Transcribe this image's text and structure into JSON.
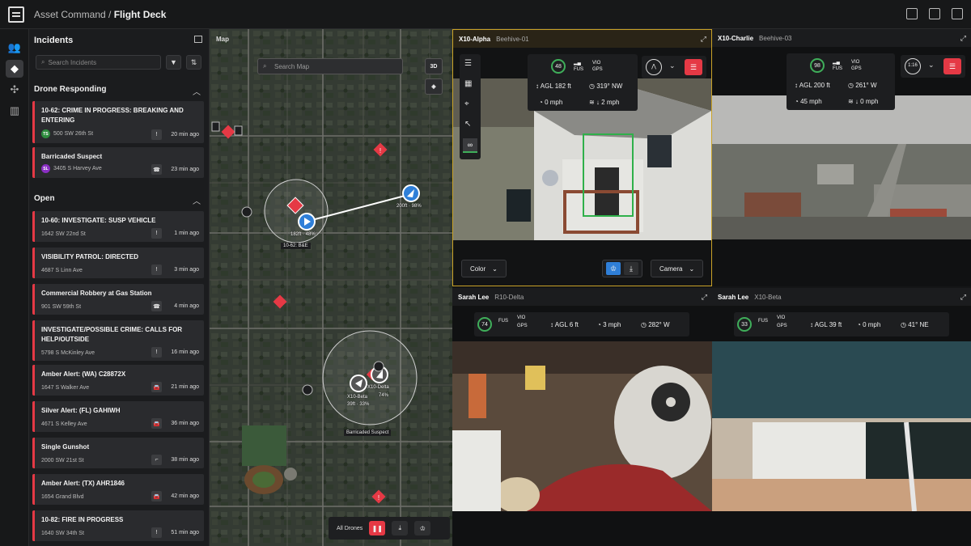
{
  "app": {
    "org": "Asset Command",
    "sep": " / ",
    "page": "Flight Deck"
  },
  "incidents": {
    "title": "Incidents",
    "search_placeholder": "Search Incidents",
    "drone_responding_label": "Drone Responding",
    "open_label": "Open",
    "responding": [
      {
        "title": "10-62: CRIME IN PROGRESS: BREAKING AND ENTERING",
        "initials": "TS",
        "avatar_color": "#2e8b3e",
        "address": "500 SW 26th St",
        "icon": "!",
        "time": "20 min ago"
      },
      {
        "title": "Barricaded Suspect",
        "initials": "SL",
        "avatar_color": "#8a2fc2",
        "address": "3405 S Harvey Ave",
        "icon": "☎",
        "time": "23 min ago"
      }
    ],
    "open": [
      {
        "title": "10-60: INVESTIGATE: SUSP VEHICLE",
        "address": "1642 SW 22nd St",
        "icon": "!",
        "time": "1 min ago"
      },
      {
        "title": "VISIBILITY PATROL: DIRECTED",
        "address": "4687 S Linn Ave",
        "icon": "!",
        "time": "3 min ago"
      },
      {
        "title": "Commercial Robbery at Gas Station",
        "address": "901 SW 59th St",
        "icon": "☎",
        "time": "4 min ago"
      },
      {
        "title": "INVESTIGATE/POSSIBLE CRIME: CALLS FOR HELP/OUTSIDE",
        "address": "5798 S McKinley Ave",
        "icon": "!",
        "time": "16 min ago"
      },
      {
        "title": "Amber Alert: (WA) C28872X",
        "address": "1647 S Walker Ave",
        "icon": "🚘",
        "time": "21 min ago"
      },
      {
        "title": "Silver Alert: (FL) GAHIWH",
        "address": "4671 S Kelley Ave",
        "icon": "🚘",
        "time": "36 min ago"
      },
      {
        "title": "Single Gunshot",
        "address": "2000 SW 21st St",
        "icon": "⌐",
        "time": "38 min ago"
      },
      {
        "title": "Amber Alert: (TX) AHR1846",
        "address": "1654 Grand Blvd",
        "icon": "🚘",
        "time": "42 min ago"
      },
      {
        "title": "10-82: FIRE IN PROGRESS",
        "address": "1640 SW 34th St",
        "icon": "!",
        "time": "51 min ago"
      }
    ]
  },
  "map": {
    "label": "Map",
    "search_placeholder": "Search Map",
    "btn_3d": "3D",
    "drone1_label": "182ft · 48%",
    "drone2_label": "200ft · 98%",
    "incident1_label": "10-62: B&E",
    "cluster_label": "Barricaded Suspect",
    "x10beta_label": "X10-Beta",
    "x10beta_stats": "39ft · 33%",
    "x10delta_label": "X10-Delta",
    "x10delta_pct": "74%",
    "all_drones": "All Drones"
  },
  "feeds": {
    "alpha": {
      "name": "X10-Alpha",
      "sub": "Beehive-01",
      "battery": "48",
      "fus": "FUS",
      "vio": "VIO",
      "gps": "GPS",
      "agl": "AGL 182 ft",
      "heading": "319° NW",
      "speed": "0 mph",
      "wind": "2 mph",
      "color_btn": "Color",
      "camera_btn": "Camera"
    },
    "charlie": {
      "name": "X10-Charlie",
      "sub": "Beehive-03",
      "battery": "98",
      "fus": "FUS",
      "vio": "VIO",
      "gps": "GPS",
      "agl": "AGL 200 ft",
      "heading": "261° W",
      "speed": "45 mph",
      "wind": "0 mph",
      "zoom": "1:16"
    },
    "delta": {
      "name": "Sarah Lee",
      "sub": "R10-Delta",
      "battery": "74",
      "fus": "FUS",
      "vio": "VIO",
      "gps": "GPS",
      "agl": "AGL 6 ft",
      "speed": "3 mph",
      "heading": "282° W"
    },
    "beta": {
      "name": "Sarah Lee",
      "sub": "X10-Beta",
      "battery": "33",
      "fus": "FUS",
      "vio": "VIO",
      "gps": "GPS",
      "agl": "AGL 39 ft",
      "speed": "0 mph",
      "heading": "41° NE"
    }
  },
  "colors": {
    "alert": "#e53945",
    "accent": "#2f7fd8",
    "selected_border": "#c9a227",
    "battery_ok": "#3fae5a"
  }
}
